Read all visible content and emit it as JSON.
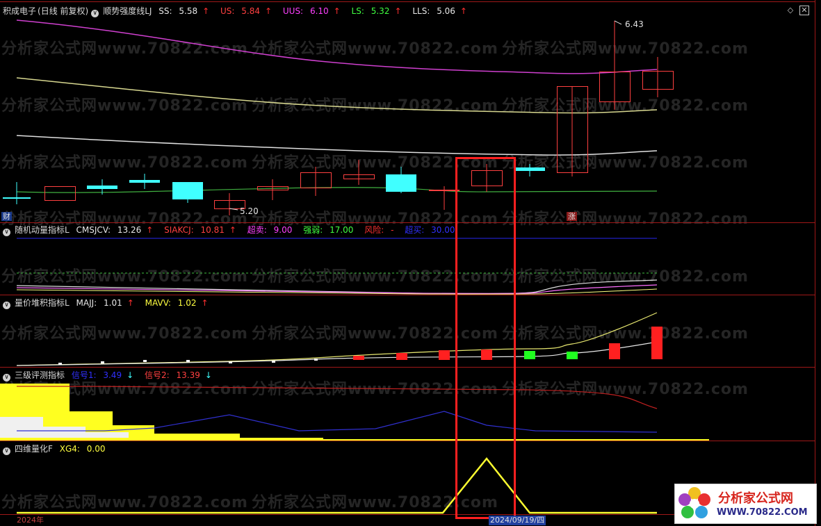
{
  "main_panel": {
    "title": "积成电子",
    "period": "(日线 前复权)",
    "indicator_name": "顺势强度线LJ",
    "values": [
      {
        "label": "SS:",
        "value": "5.58",
        "color": "#e8e8e8",
        "arrow": "↑"
      },
      {
        "label": "US:",
        "value": "5.84",
        "color": "#ff4040",
        "arrow": "↑"
      },
      {
        "label": "UUS:",
        "value": "6.10",
        "color": "#ff40ff",
        "arrow": "↑"
      },
      {
        "label": "LS:",
        "value": "5.32",
        "color": "#40ff40",
        "arrow": "↑"
      },
      {
        "label": "LLS:",
        "value": "5.06",
        "color": "#e8e8e8",
        "arrow": "↑"
      }
    ],
    "high_marker": "6.43",
    "low_marker": "5.20",
    "left_tag": "财",
    "right_tag": "涨"
  },
  "panel2": {
    "name": "随机动量指标L",
    "values": [
      {
        "label": "CMSJCV:",
        "value": "13.26",
        "color": "#e8e8e8",
        "arrow": "↑"
      },
      {
        "label": "SIAKCJ:",
        "value": "10.81",
        "color": "#ff4040",
        "arrow": "↑"
      },
      {
        "label": "超卖:",
        "value": "9.00",
        "color": "#ff40ff",
        "arrow": ""
      },
      {
        "label": "强弱:",
        "value": "17.00",
        "color": "#40ff40",
        "arrow": ""
      },
      {
        "label": "风险:",
        "value": "-",
        "color": "#ff3030",
        "arrow": ""
      },
      {
        "label": "超买:",
        "value": "30.00",
        "color": "#3030ff",
        "arrow": ""
      }
    ]
  },
  "panel3": {
    "name": "量价堆积指标L",
    "values": [
      {
        "label": "MAJJ:",
        "value": "1.01",
        "color": "#e8e8e8",
        "arrow": "↑"
      },
      {
        "label": "MAVV:",
        "value": "1.02",
        "color": "#ffff40",
        "arrow": "↑"
      }
    ]
  },
  "panel4": {
    "name": "三级评测指标",
    "values": [
      {
        "label": "信号1:",
        "value": "3.49",
        "color": "#3030ff",
        "arrow": "↓"
      },
      {
        "label": "信号2:",
        "value": "13.39",
        "color": "#ff4040",
        "arrow": "↓"
      }
    ]
  },
  "panel5": {
    "name": "四维量化F",
    "values": [
      {
        "label": "XG4:",
        "value": "0.00",
        "color": "#ffff40",
        "arrow": ""
      }
    ]
  },
  "axis": {
    "year_label": "2024年",
    "date_label": "2024/09/19/四"
  },
  "watermark": "分析家公式网www.70822.com",
  "logo": {
    "text": "分析家公式网",
    "url": "WWW.70822.COM"
  },
  "colors": {
    "up_candle": "#ff4040",
    "down_candle": "#40ffff",
    "highlight_box": "#ff2020",
    "panel_divider": "#a01818"
  }
}
